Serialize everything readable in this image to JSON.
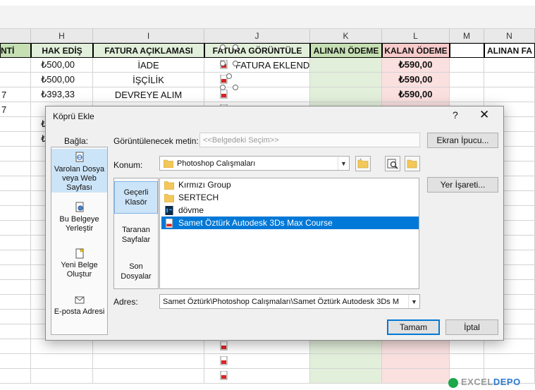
{
  "sheet": {
    "columns": [
      {
        "letter": "",
        "w": 44
      },
      {
        "letter": "H",
        "w": 88
      },
      {
        "letter": "I",
        "w": 158
      },
      {
        "letter": "J",
        "w": 150
      },
      {
        "letter": "K",
        "w": 102
      },
      {
        "letter": "L",
        "w": 96
      },
      {
        "letter": "M",
        "w": 49
      },
      {
        "letter": "N",
        "w": 72
      }
    ],
    "headers": [
      "NTİ",
      "HAK EDİŞ",
      "FATURA AÇIKLAMASI",
      "FATURA GÖRÜNTÜLE",
      "ALINAN ÖDEME",
      "KALAN ÖDEME",
      "",
      "ALINAN FA"
    ],
    "rows": [
      {
        "g": "",
        "hak": "₺500,00",
        "acik": "İADE",
        "gor": "FATURA EKLENDİ",
        "kalan": "₺590,00"
      },
      {
        "g": "",
        "hak": "₺500,00",
        "acik": "İŞÇİLİK",
        "gor": "",
        "kalan": "₺590,00"
      },
      {
        "g": "7",
        "hak": "₺393,33",
        "acik": "DEVREYE ALIM",
        "gor": "",
        "kalan": "₺590,00"
      },
      {
        "g": "7",
        "hak": "",
        "acik": "",
        "gor": "",
        "kalan": ""
      },
      {
        "g": "",
        "hak": "₺",
        "acik": "",
        "gor": "",
        "kalan": ""
      },
      {
        "g": "",
        "hak": "₺",
        "acik": "",
        "gor": "",
        "kalan": ""
      }
    ],
    "watermark": {
      "prefix": "EXCEL",
      "suffix": "DEPO"
    }
  },
  "dialog": {
    "title": "Köprü Ekle",
    "help": "?",
    "close": "✕",
    "link_to_label": "Bağla:",
    "link_types": [
      {
        "label": "Varolan Dosya veya Web Sayfası",
        "icon": "existing-file-icon",
        "selected": true
      },
      {
        "label": "Bu Belgeye Yerleştir",
        "icon": "place-in-document-icon",
        "selected": false
      },
      {
        "label": "Yeni Belge Oluştur",
        "icon": "new-document-icon",
        "selected": false
      },
      {
        "label": "E-posta Adresi",
        "icon": "email-icon",
        "selected": false
      }
    ],
    "display_text_label": "Görüntülenecek metin:",
    "display_text_value": "<<Belgedeki Seçim>>",
    "screen_tip_button": "Ekran İpucu...",
    "look_in_label": "Konum:",
    "look_in_value": "Photoshop Calışmaları",
    "browse_side": [
      {
        "label": "Geçerli Klasör",
        "selected": true
      },
      {
        "label": "Taranan Sayfalar",
        "selected": false
      },
      {
        "label": "Son Dosyalar",
        "selected": false
      }
    ],
    "files": [
      {
        "name": "Kırmızı Group",
        "icon": "folder-icon",
        "selected": false
      },
      {
        "name": "SERTECH",
        "icon": "folder-icon",
        "selected": false
      },
      {
        "name": "dövme",
        "icon": "photoshop-file-icon",
        "selected": false
      },
      {
        "name": "Samet Öztürk Autodesk 3Ds Max Course",
        "icon": "pdf-file-icon",
        "selected": true
      }
    ],
    "bookmark_button": "Yer İşareti...",
    "address_label": "Adres:",
    "address_value": "Samet Öztürk\\Photoshop Calışmaları\\Samet Öztürk Autodesk 3Ds M",
    "ok_button": "Tamam",
    "cancel_button": "İptal"
  }
}
